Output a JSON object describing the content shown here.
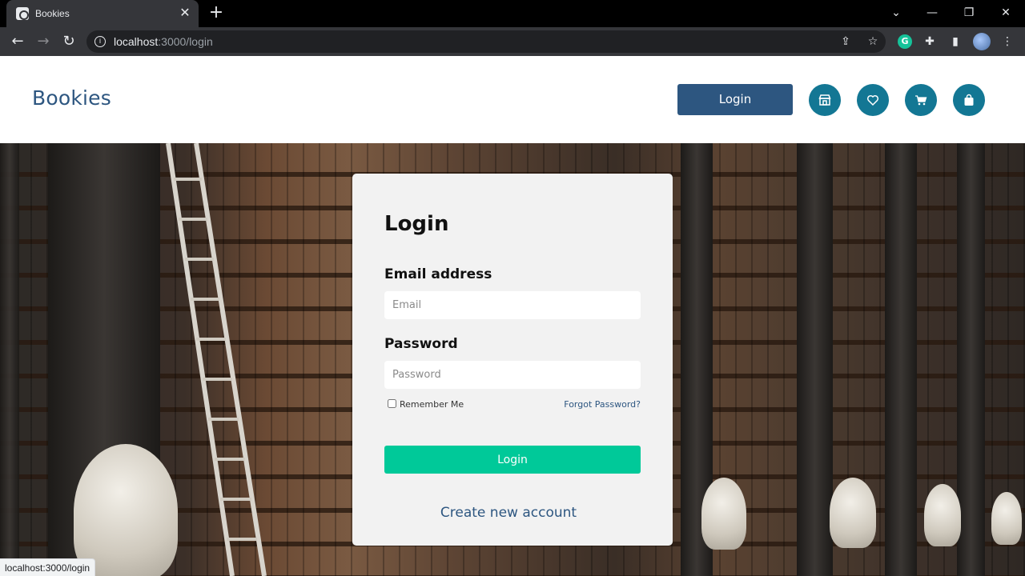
{
  "browser": {
    "tab_title": "Bookies",
    "tab_close": "✕",
    "new_tab": "+",
    "url_host": "localhost",
    "url_path": ":3000/login",
    "status_url": "localhost:3000/login"
  },
  "header": {
    "brand": "Bookies",
    "login_label": "Login",
    "icons": [
      "store-icon",
      "heart-icon",
      "cart-icon",
      "bag-icon"
    ]
  },
  "login": {
    "title": "Login",
    "email_label": "Email address",
    "email_placeholder": "Email",
    "email_value": "",
    "password_label": "Password",
    "password_placeholder": "Password",
    "password_value": "",
    "remember_label": "Remember Me",
    "remember_checked": false,
    "forgot_label": "Forgot Password?",
    "submit_label": "Login",
    "create_account_label": "Create new account"
  },
  "colors": {
    "brand": "#2d5680",
    "icon_circle": "#137794",
    "submit": "#00c999",
    "card": "#f2f2f2"
  }
}
